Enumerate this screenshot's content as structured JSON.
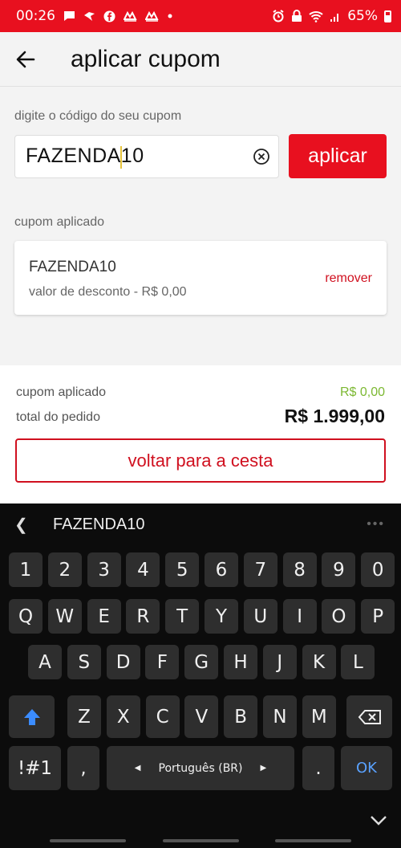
{
  "status_bar": {
    "time": "00:26",
    "battery": "65%",
    "color": "#e8101f"
  },
  "header": {
    "title": "aplicar cupom",
    "back_icon": "arrow-left-icon"
  },
  "coupon": {
    "input_label": "digite o código do seu cupom",
    "input_value_before_caret": "FAZENDA",
    "input_value_after_caret": "10",
    "apply_label": "aplicar",
    "applied_label": "cupom aplicado",
    "applied_card": {
      "code": "FAZENDA10",
      "description": "valor de desconto - R$ 0,00",
      "remove_label": "remover"
    }
  },
  "summary": {
    "coupon_label": "cupom aplicado",
    "coupon_value": "R$ 0,00",
    "total_label": "total do pedido",
    "total_value": "R$ 1.999,00",
    "back_button_label": "voltar para a cesta"
  },
  "keyboard": {
    "suggestion": "FAZENDA10",
    "row_numbers": [
      "1",
      "2",
      "3",
      "4",
      "5",
      "6",
      "7",
      "8",
      "9",
      "0"
    ],
    "row_1": [
      "Q",
      "W",
      "E",
      "R",
      "T",
      "Y",
      "U",
      "I",
      "O",
      "P"
    ],
    "row_2": [
      "A",
      "S",
      "D",
      "F",
      "G",
      "H",
      "J",
      "K",
      "L"
    ],
    "row_3": [
      "Z",
      "X",
      "C",
      "V",
      "B",
      "N",
      "M"
    ],
    "symbols_label": "!#1",
    "comma_label": ",",
    "language_label": "Português (BR)",
    "period_label": ".",
    "ok_label": "OK"
  }
}
